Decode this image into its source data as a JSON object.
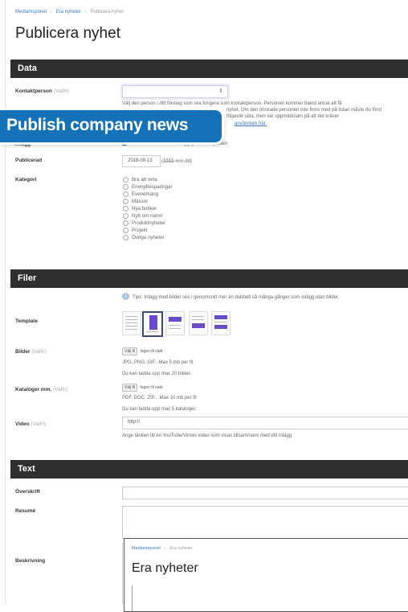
{
  "breadcrumb": [
    "Mediamsponel",
    "Era nyheter",
    "Publicera nyhet"
  ],
  "page_title": "Publicera nyhet",
  "banner_text": "Publish company news",
  "sections": {
    "data": "Data",
    "files": "Filer",
    "text": "Text"
  },
  "optional_tag": "(Valfri)",
  "contact": {
    "label": "Kontaktperson",
    "help_lines": [
      "Välj den person i ditt företag som ska fungera som kontaktperson. Personen kommer bland annat att få",
      "nyhet. Om den önskade personen inte finns med på listan måste du först",
      "följande sida, men var uppmärksam på att det kräver",
      "användare här."
    ],
    "help_link": "användare här."
  },
  "posts": {
    "label": "Inlägg",
    "checkbox_text": "Tillåt besökare skriva inlägg gällande nyheten"
  },
  "published": {
    "label": "Publicerad",
    "value": "2018-09-13",
    "hint": "(åååå-mm-dd)"
  },
  "category": {
    "label": "Kategori",
    "options": [
      "Bra att veta",
      "Energibesparingar",
      "Evenemang",
      "Mässor",
      "Nya butiker",
      "Nytt om namn",
      "Produktnyheter",
      "Projekt",
      "Övriga nyheter"
    ]
  },
  "files": {
    "tip": "Tips: Inlägg med bilder ses i genomsnitt mer än dubbelt så många gånger som inlägg utan bilder.",
    "template_label": "Template",
    "images": {
      "label": "Bilder",
      "button": "Välj fil",
      "no_file": "Ingen fil vald",
      "formats": "JPG, PNG, GIF.. Max 5 mb per fil.",
      "limit": "Du kan ladda upp max 20 bilder."
    },
    "catalogs": {
      "label": "Kataloger mm.",
      "button": "Välj fil",
      "no_file": "Ingen fil vald",
      "formats": "PDF, DOC, ZIP... Max 10 mb per fil",
      "limit": "Du kan ladda upp max 5 kataloger."
    },
    "video": {
      "label": "Video",
      "value": "http://",
      "help": "Ange länken till en YouTube/Vimeo video som visas tillsammans med ditt inlägg."
    }
  },
  "text": {
    "heading_label": "Överskrift",
    "summary_label": "Resumé",
    "description_label": "Beskrivning"
  },
  "inset": {
    "breadcrumb": [
      "Mediamsponel",
      "Era nyheter"
    ],
    "title": "Era nyheter"
  },
  "colors": {
    "section_bar": "#2f2f2f",
    "banner": "#1672b8",
    "accent": "#3b78b8",
    "template_block": "#6a4bc9"
  }
}
